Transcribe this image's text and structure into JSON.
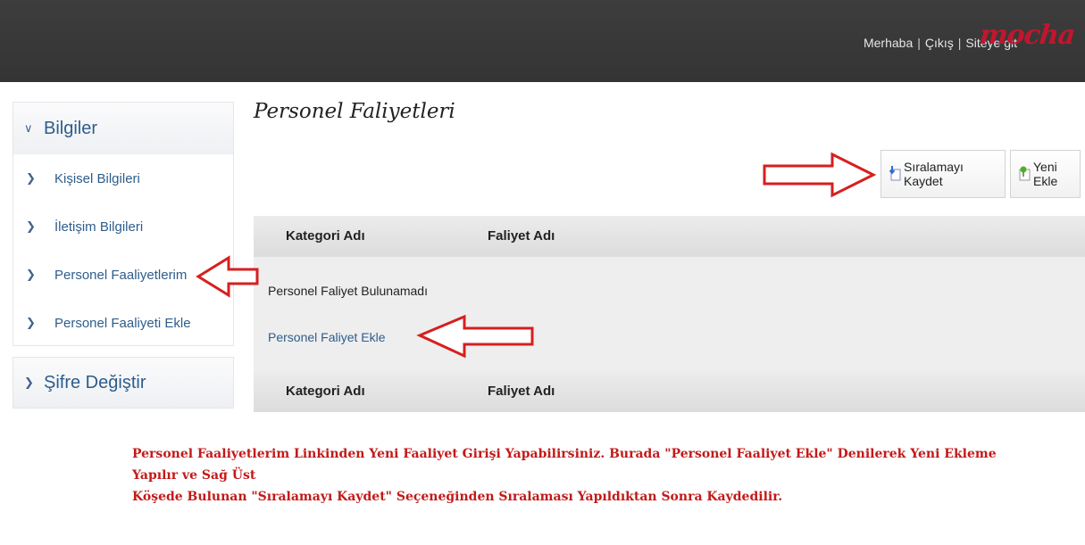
{
  "header": {
    "links": [
      "Merhaba",
      "Çıkış",
      "Siteye git"
    ],
    "separator": "|",
    "logo_text": "mocha",
    "background": "#383838",
    "logo_color": "#c2162e"
  },
  "sidebar": {
    "group1": {
      "title": "Bilgiler",
      "expanded": true,
      "items": [
        {
          "label": "Kişisel Bilgileri"
        },
        {
          "label": "İletişim Bilgileri"
        },
        {
          "label": "Personel Faaliyetlerim"
        },
        {
          "label": "Personel Faaliyeti Ekle"
        }
      ]
    },
    "group2": {
      "title": "Şifre Değiştir",
      "expanded": false
    }
  },
  "main": {
    "title": "Personel Faliyetleri",
    "toolbar": {
      "save_label": "Sıralamayı Kaydet",
      "save_icon": "sort-save-icon",
      "new_label": "Yeni Ekle",
      "new_icon": "add-pin-icon"
    },
    "table": {
      "columns": [
        "Kategori Adı",
        "Faliyet Adı"
      ],
      "empty_message": "Personel Faliyet Bulunamadı",
      "add_link": "Personel Faliyet Ekle"
    }
  },
  "note": {
    "line1": "Personel Faaliyetlerim Linkinden Yeni Faaliyet Girişi Yapabilirsiniz. Burada \"Personel Faaliyet Ekle\" Denilerek Yeni Ekleme Yapılır ve Sağ Üst",
    "line2": "Köşede Bulunan \"Sıralamayı Kaydet\" Seçeneğinden Sıralaması Yapıldıktan Sonra Kaydedilir.",
    "color": "#c21a1a"
  },
  "annotation_color": "#d61f1f"
}
